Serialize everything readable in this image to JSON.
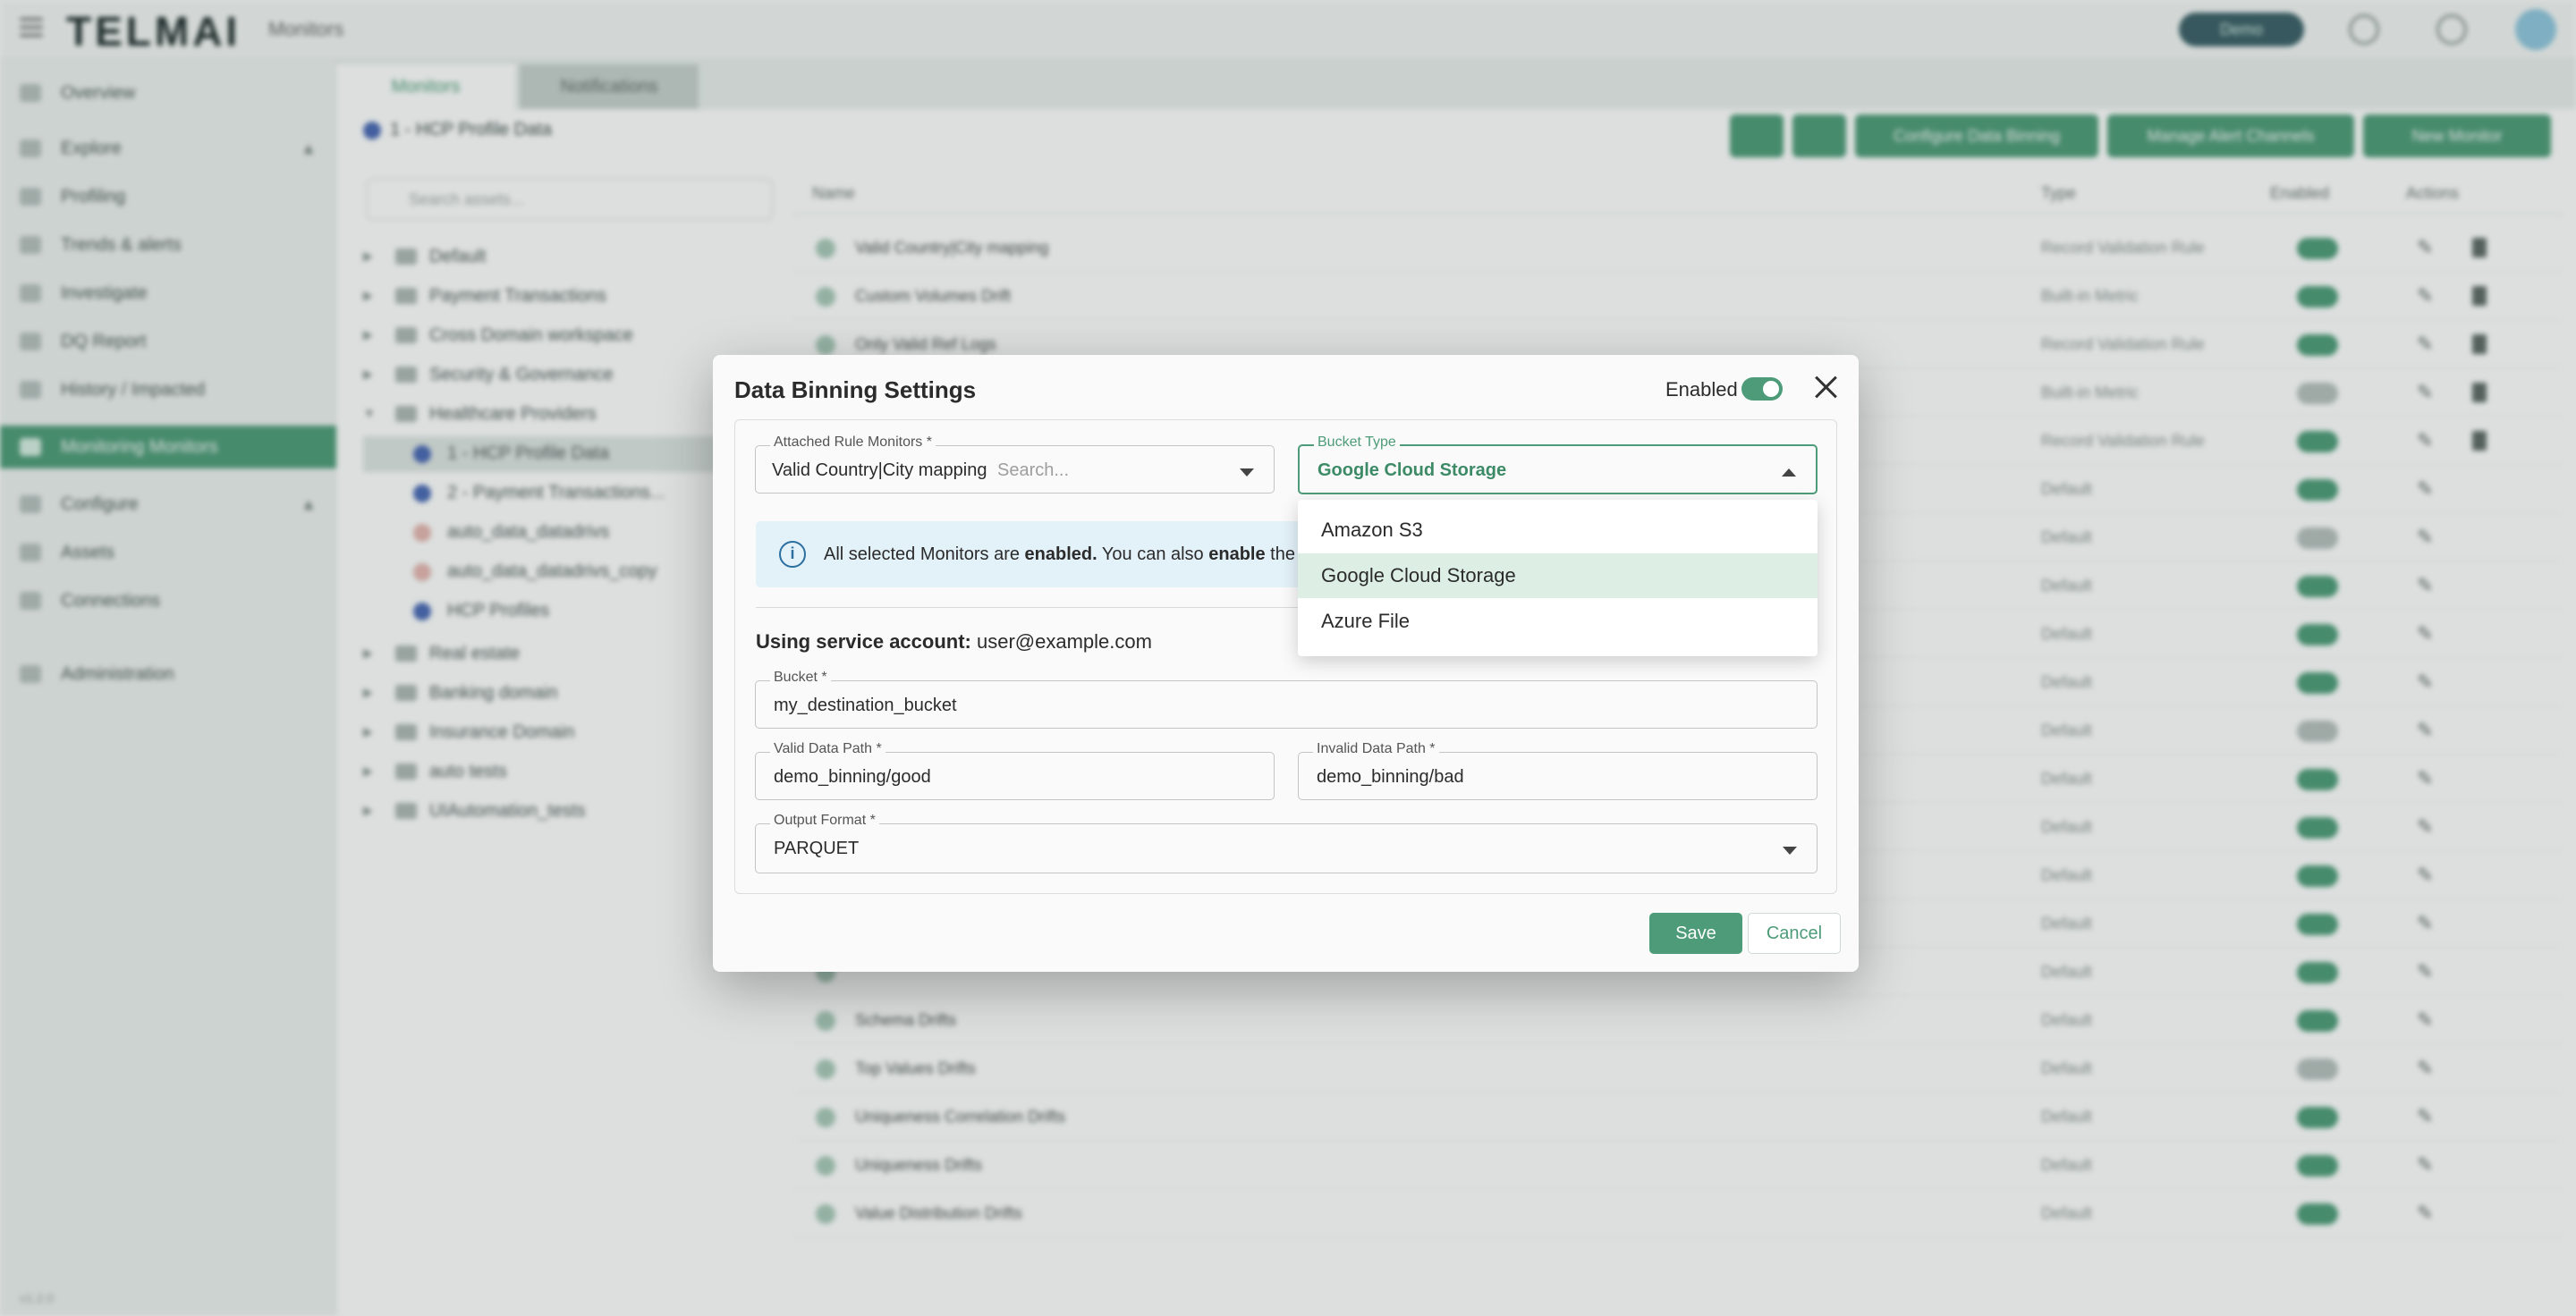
{
  "app": {
    "logo": "TELMAI",
    "page": "Monitors",
    "top_pill": "Demo",
    "version": "v1.2.0"
  },
  "sidebar": {
    "items": [
      {
        "label": "Overview"
      },
      {
        "label": "Explore"
      },
      {
        "label": "Profiling"
      },
      {
        "label": "Trends & alerts"
      },
      {
        "label": "Investigate"
      },
      {
        "label": "DQ Report"
      },
      {
        "label": "History / Impacted"
      },
      {
        "label": "Monitoring Monitors"
      },
      {
        "label": "Configure"
      },
      {
        "label": "Assets"
      },
      {
        "label": "Connections"
      },
      {
        "label": "Administration"
      }
    ]
  },
  "tabs": [
    {
      "label": "Monitors"
    },
    {
      "label": "Notifications"
    }
  ],
  "breadcrumb": "1 - HCP Profile Data",
  "toolbar": {
    "btn1": "Configure Data Binning",
    "btn2": "Manage Alert Channels",
    "btn3": "New Monitor"
  },
  "search": {
    "placeholder": "Search assets..."
  },
  "tree": [
    {
      "label": "Default"
    },
    {
      "label": "Payment Transactions"
    },
    {
      "label": "Cross Domain workspace"
    },
    {
      "label": "Security & Governance"
    },
    {
      "label": "Healthcare Providers"
    },
    {
      "label": "1 - HCP Profile Data"
    },
    {
      "label": "2 - Payment Transactions..."
    },
    {
      "label": "auto_data_datadrivs"
    },
    {
      "label": "auto_data_datadrivs_copy"
    },
    {
      "label": "HCP Profiles"
    },
    {
      "label": "Real estate"
    },
    {
      "label": "Banking domain"
    },
    {
      "label": "Insurance Domain"
    },
    {
      "label": "auto tests"
    },
    {
      "label": "UIAutomation_tests"
    }
  ],
  "table": {
    "headers": {
      "name": "Name",
      "type": "Type",
      "enabled": "Enabled",
      "actions": "Actions"
    },
    "rows": [
      {
        "name": "Valid Country|City mapping",
        "type": "Record Validation Rule"
      },
      {
        "name": "Custom Volumes Drift",
        "type": "Built-in Metric"
      },
      {
        "name": "Only Valid Ref Logs",
        "type": "Record Validation Rule"
      },
      {
        "name": "",
        "type": "Built-in Metric"
      },
      {
        "name": "",
        "type": "Record Validation Rule"
      },
      {
        "name": "",
        "type": "Default"
      },
      {
        "name": "",
        "type": "Default"
      },
      {
        "name": "",
        "type": "Default"
      },
      {
        "name": "",
        "type": "Default"
      },
      {
        "name": "",
        "type": "Default"
      },
      {
        "name": "",
        "type": "Default"
      },
      {
        "name": "",
        "type": "Default"
      },
      {
        "name": "",
        "type": "Default"
      },
      {
        "name": "",
        "type": "Default"
      },
      {
        "name": "",
        "type": "Default"
      },
      {
        "name": "",
        "type": "Default"
      },
      {
        "name": "Schema Drifts",
        "type": "Default"
      },
      {
        "name": "Top Values Drifts",
        "type": "Default"
      },
      {
        "name": "Uniqueness Correlation Drifts",
        "type": "Default"
      },
      {
        "name": "Uniqueness Drifts",
        "type": "Default"
      },
      {
        "name": "Value Distribution Drifts",
        "type": "Default"
      }
    ]
  },
  "modal": {
    "title": "Data Binning Settings",
    "enabled_label": "Enabled",
    "enabled": true,
    "attached": {
      "label": "Attached Rule Monitors *",
      "value": "Valid Country|City mapping",
      "placeholder": "Search..."
    },
    "bucket_type": {
      "label": "Bucket Type",
      "value": "Google Cloud Storage",
      "options": [
        "Amazon S3",
        "Google Cloud Storage",
        "Azure File"
      ]
    },
    "info": {
      "part1": "All selected Monitors are ",
      "bold1": "enabled.",
      "part2": " You can also ",
      "bold2": "enable",
      "part3": " the D"
    },
    "service_account": {
      "label": "Using service account:",
      "value": "user@example.com"
    },
    "bucket": {
      "label": "Bucket *",
      "value": "my_destination_bucket"
    },
    "valid_path": {
      "label": "Valid Data Path *",
      "value": "demo_binning/good"
    },
    "invalid_path": {
      "label": "Invalid Data Path *",
      "value": "demo_binning/bad"
    },
    "output_format": {
      "label": "Output Format *",
      "value": "PARQUET"
    },
    "save": "Save",
    "cancel": "Cancel"
  },
  "colors": {
    "accent": "#4d9b78",
    "info_bg": "#e3f1f9",
    "selected_option": "#ddefe4"
  }
}
